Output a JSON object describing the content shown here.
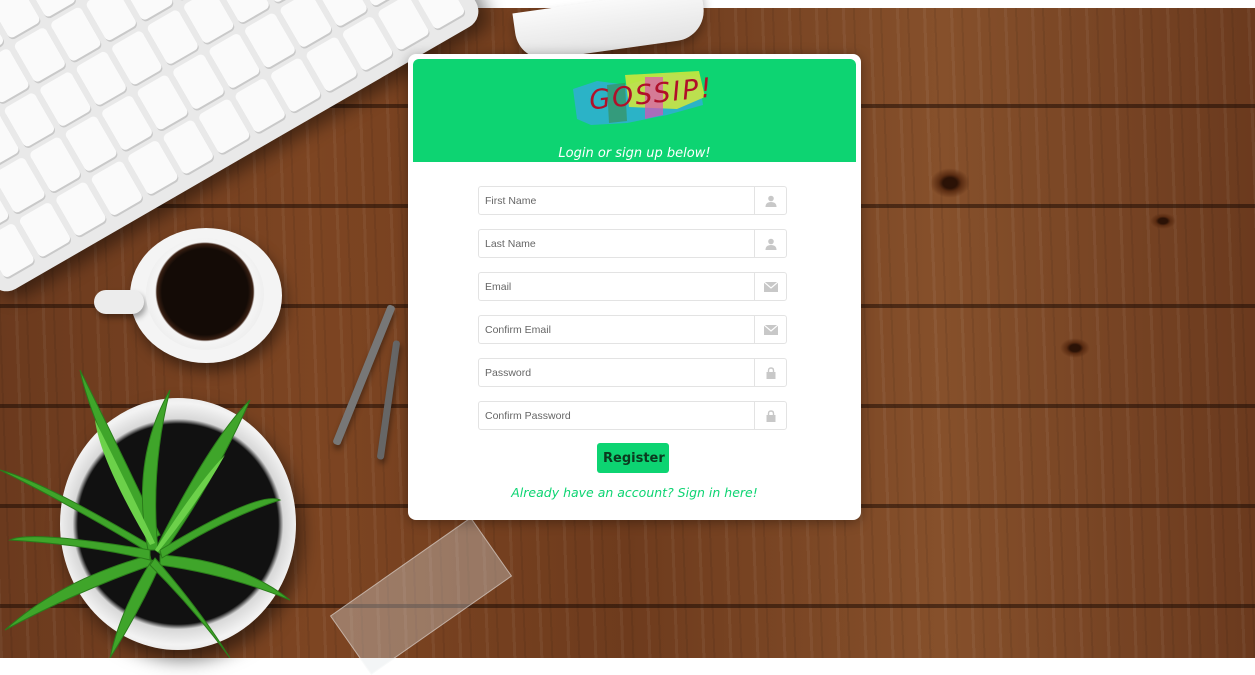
{
  "app": {
    "logo_text": "GOSSIP!",
    "tagline": "Login or sign up below!"
  },
  "form": {
    "fields": [
      {
        "placeholder": "First Name",
        "icon": "user-icon"
      },
      {
        "placeholder": "Last Name",
        "icon": "user-icon"
      },
      {
        "placeholder": "Email",
        "icon": "envelope-icon"
      },
      {
        "placeholder": "Confirm Email",
        "icon": "envelope-icon"
      },
      {
        "placeholder": "Password",
        "icon": "lock-icon"
      },
      {
        "placeholder": "Confirm Password",
        "icon": "lock-icon"
      }
    ],
    "register_label": "Register",
    "signin_link": "Already have an account? Sign in here!"
  },
  "colors": {
    "accent": "#0dd472",
    "logo_red": "#b0102a",
    "icon_grey": "#c8c8c8"
  }
}
